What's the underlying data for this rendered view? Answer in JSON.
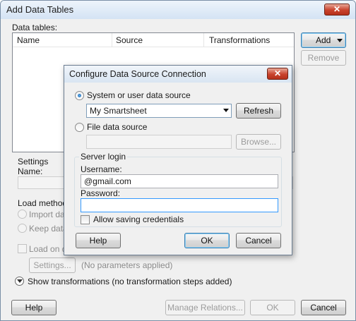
{
  "outer": {
    "title": "Add Data Tables",
    "close_label": "✕",
    "data_tables_label": "Data tables:",
    "columns": [
      "Name",
      "Source",
      "Transformations"
    ],
    "add_label": "Add",
    "remove_label": "Remove",
    "settings_label": "Settings",
    "name_label": "Name:",
    "load_method_label": "Load method:",
    "import_label": "Import data t",
    "keep_label": "Keep data ta",
    "load_on_demand_label": "Load on dem",
    "settings_btn": "Settings...",
    "no_params": "(No parameters applied)",
    "show_transform": "Show transformations (no transformation steps added)",
    "help": "Help",
    "manage_relations": "Manage Relations...",
    "ok": "OK",
    "cancel": "Cancel"
  },
  "dialog": {
    "title": "Configure Data Source Connection",
    "close_label": "✕",
    "system_source_label": "System or user data source",
    "source_selected": "My Smartsheet",
    "refresh": "Refresh",
    "file_source_label": "File data source",
    "file_path_value": "",
    "browse": "Browse...",
    "server_login_label": "Server login",
    "username_label": "Username:",
    "username_value": "@gmail.com",
    "password_label": "Password:",
    "password_value": "",
    "allow_saving_label": "Allow saving credentials",
    "help": "Help",
    "ok": "OK",
    "cancel": "Cancel"
  }
}
